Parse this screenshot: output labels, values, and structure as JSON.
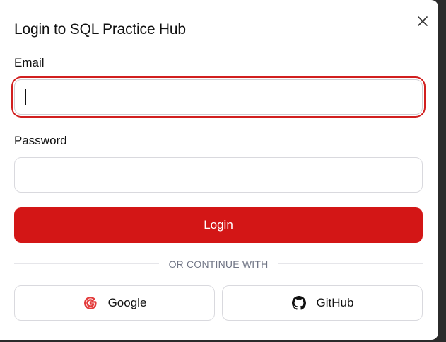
{
  "dialog": {
    "title": "Login to SQL Practice Hub",
    "close_icon": "close-icon"
  },
  "form": {
    "email_label": "Email",
    "email_value": "",
    "email_placeholder": "",
    "password_label": "Password",
    "password_value": "",
    "password_placeholder": "",
    "submit_label": "Login"
  },
  "divider": {
    "text": "OR CONTINUE WITH"
  },
  "social": {
    "google_label": "Google",
    "google_icon": "google-icon",
    "github_label": "GitHub",
    "github_icon": "github-icon"
  },
  "colors": {
    "accent": "#d31616",
    "focus_ring": "#d11f1f",
    "google_red": "#e33b3b"
  }
}
